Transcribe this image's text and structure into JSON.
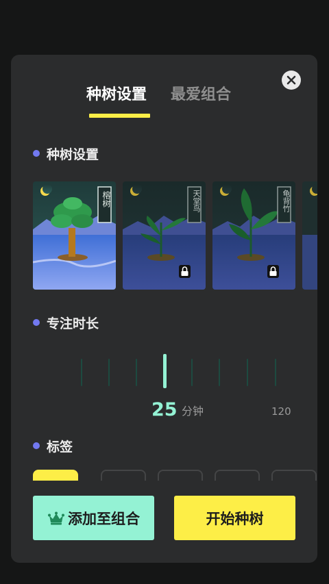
{
  "tabs": [
    {
      "label": "种树设置",
      "active": true
    },
    {
      "label": "最爱组合",
      "active": false
    }
  ],
  "sections": {
    "tree": "种树设置",
    "duration": "专注时长",
    "tags": "标签"
  },
  "trees": [
    {
      "name": "榕树",
      "locked": false
    },
    {
      "name": "天堂鸟",
      "locked": true
    },
    {
      "name": "龟背竹",
      "locked": true
    }
  ],
  "duration": {
    "value": "25",
    "unit": "分钟",
    "max": "120"
  },
  "buttons": {
    "add": "添加至组合",
    "start": "开始种树"
  },
  "colors": {
    "accent_yellow": "#fdee47",
    "accent_mint": "#94f2d4",
    "bullet": "#7279f0",
    "panel": "#2b2c2d"
  },
  "icons": {
    "close": "close-icon",
    "lock": "lock-icon",
    "moon": "moon-icon",
    "crown": "crown-icon"
  }
}
